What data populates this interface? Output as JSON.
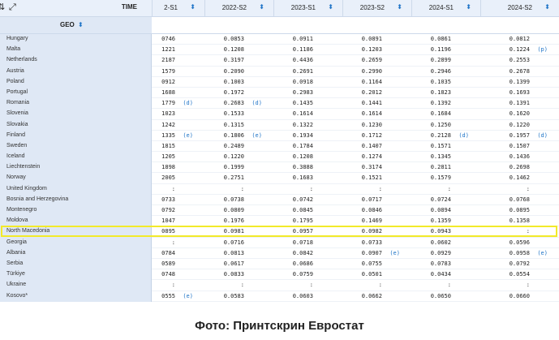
{
  "toolbar": {
    "swap_icon": "swap-arrows-icon",
    "expand_icon": "expand-icon"
  },
  "time_label": "TIME",
  "geo_label": "GEO",
  "columns": [
    "2-S1",
    "2022-S2",
    "2023-S1",
    "2023-S2",
    "2024-S1",
    "2024-S2"
  ],
  "rows": [
    {
      "country": "Hungary",
      "cells": [
        [
          "0746",
          ""
        ],
        [
          "0.0853",
          ""
        ],
        [
          "0.0911",
          ""
        ],
        [
          "0.0891",
          ""
        ],
        [
          "0.0861",
          ""
        ],
        [
          "0.0812",
          ""
        ]
      ]
    },
    {
      "country": "Malta",
      "cells": [
        [
          "1221",
          ""
        ],
        [
          "0.1208",
          ""
        ],
        [
          "0.1186",
          ""
        ],
        [
          "0.1203",
          ""
        ],
        [
          "0.1196",
          ""
        ],
        [
          "0.1224",
          "(p)"
        ]
      ]
    },
    {
      "country": "Netherlands",
      "cells": [
        [
          "2187",
          ""
        ],
        [
          "0.3197",
          ""
        ],
        [
          "0.4436",
          ""
        ],
        [
          "0.2659",
          ""
        ],
        [
          "0.2899",
          ""
        ],
        [
          "0.2553",
          ""
        ]
      ]
    },
    {
      "country": "Austria",
      "cells": [
        [
          "1579",
          ""
        ],
        [
          "0.2090",
          ""
        ],
        [
          "0.2691",
          ""
        ],
        [
          "0.2990",
          ""
        ],
        [
          "0.2946",
          ""
        ],
        [
          "0.2678",
          ""
        ]
      ]
    },
    {
      "country": "Poland",
      "cells": [
        [
          "0912",
          ""
        ],
        [
          "0.1003",
          ""
        ],
        [
          "0.0918",
          ""
        ],
        [
          "0.1164",
          ""
        ],
        [
          "0.1035",
          ""
        ],
        [
          "0.1399",
          ""
        ]
      ]
    },
    {
      "country": "Portugal",
      "cells": [
        [
          "1688",
          ""
        ],
        [
          "0.1972",
          ""
        ],
        [
          "0.2983",
          ""
        ],
        [
          "0.2012",
          ""
        ],
        [
          "0.1823",
          ""
        ],
        [
          "0.1693",
          ""
        ]
      ]
    },
    {
      "country": "Romania",
      "cells": [
        [
          "1779",
          "(d)"
        ],
        [
          "0.2683",
          "(d)"
        ],
        [
          "0.1435",
          ""
        ],
        [
          "0.1441",
          ""
        ],
        [
          "0.1392",
          ""
        ],
        [
          "0.1391",
          ""
        ]
      ]
    },
    {
      "country": "Slovenia",
      "cells": [
        [
          "1023",
          ""
        ],
        [
          "0.1533",
          ""
        ],
        [
          "0.1614",
          ""
        ],
        [
          "0.1614",
          ""
        ],
        [
          "0.1684",
          ""
        ],
        [
          "0.1620",
          ""
        ]
      ]
    },
    {
      "country": "Slovakia",
      "cells": [
        [
          "1242",
          ""
        ],
        [
          "0.1315",
          ""
        ],
        [
          "0.1322",
          ""
        ],
        [
          "0.1230",
          ""
        ],
        [
          "0.1250",
          ""
        ],
        [
          "0.1220",
          ""
        ]
      ]
    },
    {
      "country": "Finland",
      "cells": [
        [
          "1335",
          "(e)"
        ],
        [
          "0.1806",
          "(e)"
        ],
        [
          "0.1934",
          ""
        ],
        [
          "0.1712",
          ""
        ],
        [
          "0.2128",
          "(d)"
        ],
        [
          "0.1957",
          "(d)"
        ]
      ]
    },
    {
      "country": "Sweden",
      "cells": [
        [
          "1815",
          ""
        ],
        [
          "0.2489",
          ""
        ],
        [
          "0.1784",
          ""
        ],
        [
          "0.1407",
          ""
        ],
        [
          "0.1571",
          ""
        ],
        [
          "0.1507",
          ""
        ]
      ]
    },
    {
      "country": "Iceland",
      "cells": [
        [
          "1205",
          ""
        ],
        [
          "0.1220",
          ""
        ],
        [
          "0.1208",
          ""
        ],
        [
          "0.1274",
          ""
        ],
        [
          "0.1345",
          ""
        ],
        [
          "0.1436",
          ""
        ]
      ]
    },
    {
      "country": "Liechtenstein",
      "cells": [
        [
          "1898",
          ""
        ],
        [
          "0.1999",
          ""
        ],
        [
          "0.3888",
          ""
        ],
        [
          "0.3174",
          ""
        ],
        [
          "0.2811",
          ""
        ],
        [
          "0.2698",
          ""
        ]
      ]
    },
    {
      "country": "Norway",
      "cells": [
        [
          "2005",
          ""
        ],
        [
          "0.2751",
          ""
        ],
        [
          "0.1683",
          ""
        ],
        [
          "0.1521",
          ""
        ],
        [
          "0.1579",
          ""
        ],
        [
          "0.1462",
          ""
        ]
      ]
    },
    {
      "country": "United Kingdom",
      "cells": [
        [
          ":",
          ""
        ],
        [
          ":",
          ""
        ],
        [
          ":",
          ""
        ],
        [
          ":",
          ""
        ],
        [
          ":",
          ""
        ],
        [
          ":",
          ""
        ]
      ]
    },
    {
      "country": "Bosnia and Herzegovina",
      "cells": [
        [
          "0733",
          ""
        ],
        [
          "0.0738",
          ""
        ],
        [
          "0.0742",
          ""
        ],
        [
          "0.0717",
          ""
        ],
        [
          "0.0724",
          ""
        ],
        [
          "0.0768",
          ""
        ]
      ]
    },
    {
      "country": "Montenegro",
      "cells": [
        [
          "0792",
          ""
        ],
        [
          "0.0809",
          ""
        ],
        [
          "0.0845",
          ""
        ],
        [
          "0.0846",
          ""
        ],
        [
          "0.0894",
          ""
        ],
        [
          "0.0895",
          ""
        ]
      ]
    },
    {
      "country": "Moldova",
      "cells": [
        [
          "1047",
          ""
        ],
        [
          "0.1976",
          ""
        ],
        [
          "0.1795",
          ""
        ],
        [
          "0.1469",
          ""
        ],
        [
          "0.1359",
          ""
        ],
        [
          "0.1358",
          ""
        ]
      ]
    },
    {
      "country": "North Macedonia",
      "cells": [
        [
          "0895",
          ""
        ],
        [
          "0.0981",
          ""
        ],
        [
          "0.0957",
          ""
        ],
        [
          "0.0982",
          ""
        ],
        [
          "0.0943",
          ""
        ],
        [
          ":",
          ""
        ]
      ]
    },
    {
      "country": "Georgia",
      "cells": [
        [
          ":",
          ""
        ],
        [
          "0.0716",
          ""
        ],
        [
          "0.0718",
          ""
        ],
        [
          "0.0733",
          ""
        ],
        [
          "0.0602",
          ""
        ],
        [
          "0.0596",
          ""
        ]
      ]
    },
    {
      "country": "Albania",
      "cells": [
        [
          "0784",
          ""
        ],
        [
          "0.0813",
          ""
        ],
        [
          "0.0842",
          ""
        ],
        [
          "0.0907",
          "(e)"
        ],
        [
          "0.0929",
          ""
        ],
        [
          "0.0958",
          "(e)"
        ]
      ]
    },
    {
      "country": "Serbia",
      "cells": [
        [
          "0589",
          ""
        ],
        [
          "0.0617",
          ""
        ],
        [
          "0.0686",
          ""
        ],
        [
          "0.0755",
          ""
        ],
        [
          "0.0783",
          ""
        ],
        [
          "0.0792",
          ""
        ]
      ]
    },
    {
      "country": "Türkiye",
      "cells": [
        [
          "0748",
          ""
        ],
        [
          "0.0833",
          ""
        ],
        [
          "0.0759",
          ""
        ],
        [
          "0.0501",
          ""
        ],
        [
          "0.0434",
          ""
        ],
        [
          "0.0554",
          ""
        ]
      ]
    },
    {
      "country": "Ukraine",
      "cells": [
        [
          ":",
          ""
        ],
        [
          ":",
          ""
        ],
        [
          ":",
          ""
        ],
        [
          ":",
          ""
        ],
        [
          ":",
          ""
        ],
        [
          ":",
          ""
        ]
      ]
    },
    {
      "country": "Kosovo*",
      "cells": [
        [
          "0555",
          "(e)"
        ],
        [
          "0.0583",
          ""
        ],
        [
          "0.0603",
          ""
        ],
        [
          "0.0662",
          ""
        ],
        [
          "0.0650",
          ""
        ],
        [
          "0.0660",
          ""
        ]
      ]
    }
  ],
  "highlight_color": "#f2ea2a",
  "caption": "Фото: Принтскрин Евростат"
}
